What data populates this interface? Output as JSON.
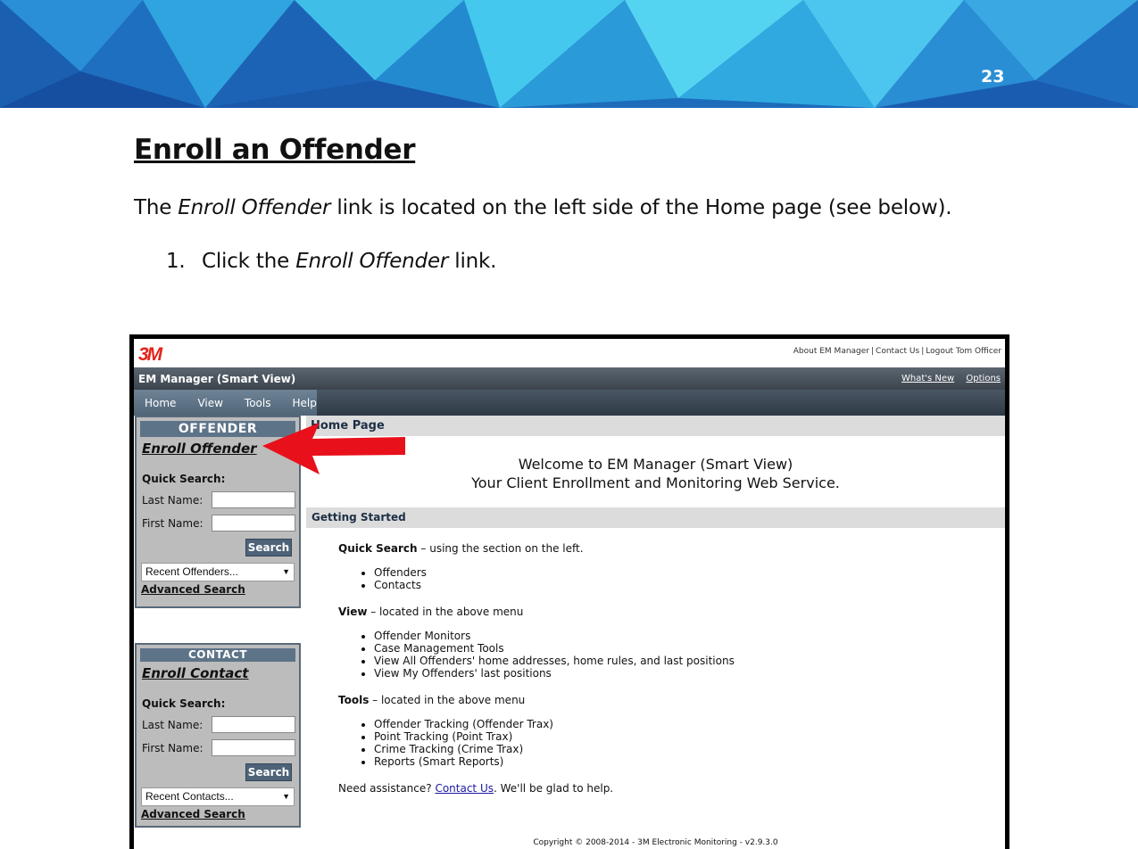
{
  "page_number": "23",
  "doc": {
    "title": "Enroll an Offender",
    "para_before": "The ",
    "para_em": "Enroll Offender",
    "para_after": " link is located on the left side of the Home page (see below).",
    "step_num": "1.",
    "step_before": "Click the ",
    "step_em": "Enroll Offender",
    "step_after": " link."
  },
  "app": {
    "logo": "3M",
    "top_links": [
      "About EM Manager",
      "Contact Us",
      "Logout Tom Officer"
    ],
    "top_sep": "|",
    "name": "EM Manager (Smart View)",
    "title_links": [
      "What's New",
      "Options"
    ],
    "menu": [
      "Home",
      "View",
      "Tools",
      "Help"
    ]
  },
  "offender_panel": {
    "heading": "OFFENDER",
    "enroll_link": "Enroll Offender",
    "quick_search": "Quick Search:",
    "last_name_label": "Last Name:",
    "first_name_label": "First Name:",
    "last_name_value": "",
    "first_name_value": "",
    "search_button": "Search",
    "recent_select": "Recent Offenders...",
    "advanced_search": "Advanced Search"
  },
  "contact_panel": {
    "heading": "CONTACT",
    "enroll_link": "Enroll Contact",
    "quick_search": "Quick Search:",
    "last_name_label": "Last Name:",
    "first_name_label": "First Name:",
    "last_name_value": "",
    "first_name_value": "",
    "search_button": "Search",
    "recent_select": "Recent Contacts...",
    "advanced_search": "Advanced Search"
  },
  "main": {
    "home_heading": "Home Page",
    "welcome_line1": "Welcome to EM Manager (Smart View)",
    "welcome_line2": "Your Client Enrollment and Monitoring Web Service.",
    "getting_started": "Getting Started",
    "quick_search_bold": "Quick Search",
    "quick_search_rest": " – using the section on the left.",
    "quick_search_items": [
      "Offenders",
      "Contacts"
    ],
    "view_bold": "View",
    "view_rest": " – located in the above menu",
    "view_items": [
      "Offender Monitors",
      "Case Management Tools",
      "View All Offenders' home addresses, home rules, and last positions",
      "View My Offenders' last positions"
    ],
    "tools_bold": "Tools",
    "tools_rest": " – located in the above menu",
    "tools_items": [
      "Offender Tracking (Offender Trax)",
      "Point Tracking (Point Trax)",
      "Crime Tracking (Crime Trax)",
      "Reports (Smart Reports)"
    ],
    "assist_before": "Need assistance? ",
    "assist_link": "Contact Us",
    "assist_after": ". We'll be glad to help.",
    "copyright": "Copyright © 2008-2014 - 3M Electronic Monitoring - v2.9.3.0"
  },
  "colors": {
    "arrow": "#e8101a",
    "panel_header": "#5d7388",
    "logo": "#e2231a"
  }
}
